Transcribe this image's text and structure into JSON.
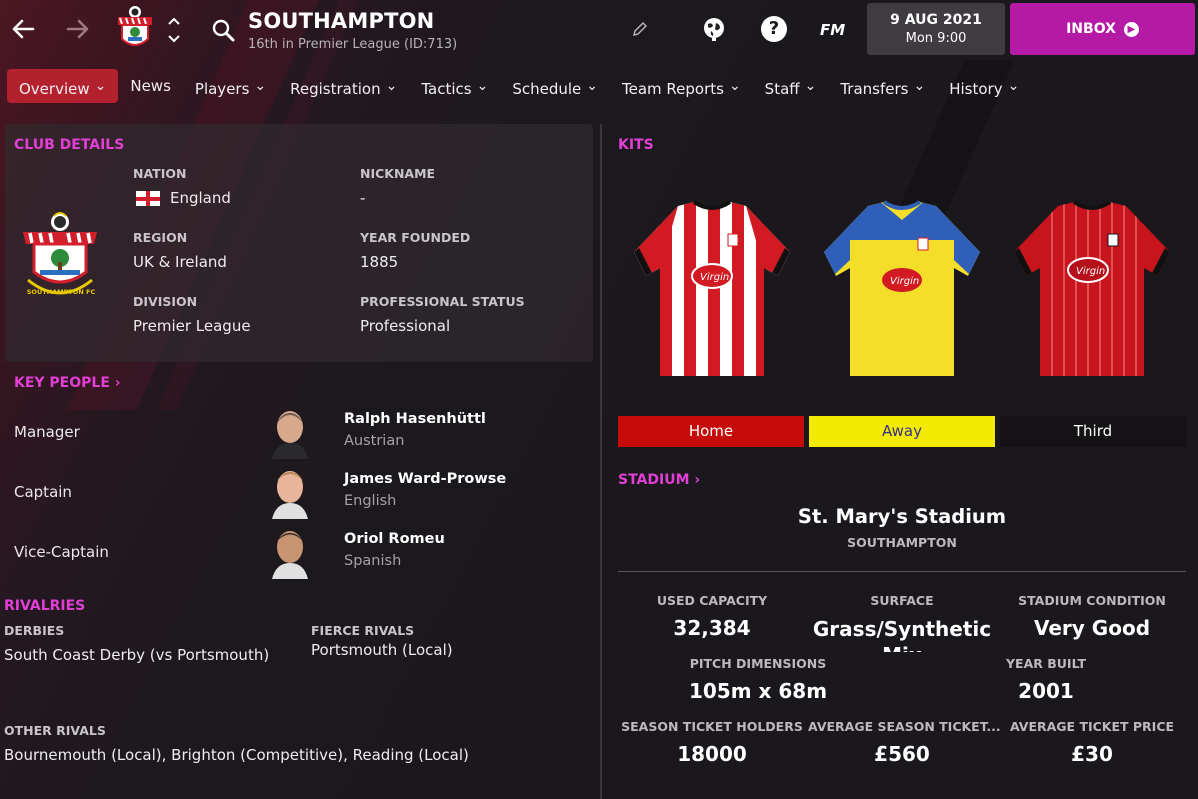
{
  "header": {
    "club_name": "SOUTHAMPTON",
    "club_subtitle": "16th in Premier League (ID:713)",
    "fm_label": "FM",
    "date": "9 AUG 2021",
    "day_time": "Mon 9:00",
    "inbox_label": "INBOX",
    "icons": [
      "back-arrow-icon",
      "forward-arrow-icon",
      "club-crest-icon",
      "up-down-chevron-icon",
      "search-icon",
      "edit-pencil-icon",
      "globe-icon",
      "help-icon",
      "fm-logo"
    ]
  },
  "tabs": [
    {
      "label": "Overview",
      "active": true
    },
    {
      "label": "News",
      "active": false,
      "plain": true
    },
    {
      "label": "Players"
    },
    {
      "label": "Registration"
    },
    {
      "label": "Tactics"
    },
    {
      "label": "Schedule"
    },
    {
      "label": "Team Reports"
    },
    {
      "label": "Staff"
    },
    {
      "label": "Transfers"
    },
    {
      "label": "History"
    }
  ],
  "club_details": {
    "title": "CLUB DETAILS",
    "crest_text": "SOUTHAMPTON FC",
    "nation_label": "NATION",
    "nation_value": "England",
    "nickname_label": "NICKNAME",
    "nickname_value": "-",
    "region_label": "REGION",
    "region_value": "UK & Ireland",
    "founded_label": "YEAR FOUNDED",
    "founded_value": "1885",
    "division_label": "DIVISION",
    "division_value": "Premier League",
    "status_label": "PROFESSIONAL STATUS",
    "status_value": "Professional"
  },
  "key_people": {
    "title": "KEY PEOPLE",
    "people": [
      {
        "role": "Manager",
        "name": "Ralph Hasenhüttl",
        "nationality": "Austrian"
      },
      {
        "role": "Captain",
        "name": "James Ward-Prowse",
        "nationality": "English"
      },
      {
        "role": "Vice-Captain",
        "name": "Oriol Romeu",
        "nationality": "Spanish"
      }
    ]
  },
  "rivalries": {
    "title": "RIVALRIES",
    "derbies_label": "DERBIES",
    "derbies_value": "South Coast Derby (vs Portsmouth)",
    "fierce_label": "FIERCE RIVALS",
    "fierce_value": "Portsmouth (Local)",
    "other_label": "OTHER RIVALS",
    "other_value": "Bournemouth (Local), Brighton (Competitive), Reading (Local)"
  },
  "kits": {
    "title": "KITS",
    "sponsor_text": "Virgin",
    "buttons": [
      {
        "label": "Home",
        "bg": "#c60b0b",
        "fg": "#ffffff"
      },
      {
        "label": "Away",
        "bg": "#f3ec00",
        "fg": "#3b2f8c"
      },
      {
        "label": "Third",
        "bg": "#141214",
        "fg": "#ffffff"
      }
    ]
  },
  "stadium": {
    "title": "STADIUM",
    "name": "St. Mary's Stadium",
    "city": "SOUTHAMPTON",
    "used_capacity_label": "USED CAPACITY",
    "used_capacity": "32,384",
    "surface_label": "SURFACE",
    "surface": "Grass/Synthetic Mix",
    "condition_label": "STADIUM CONDITION",
    "condition": "Very Good",
    "pitch_label": "PITCH DIMENSIONS",
    "pitch": "105m x 68m",
    "built_label": "YEAR BUILT",
    "built": "2001",
    "season_holders_label": "SEASON TICKET HOLDERS",
    "season_holders": "18000",
    "avg_season_label": "AVERAGE SEASON TICKET...",
    "avg_season": "£560",
    "avg_ticket_label": "AVERAGE TICKET PRICE",
    "avg_ticket": "£30"
  },
  "colors": {
    "accent": "#e23fd6",
    "tab_active": "#b3202e",
    "inbox": "#b51aa6"
  }
}
